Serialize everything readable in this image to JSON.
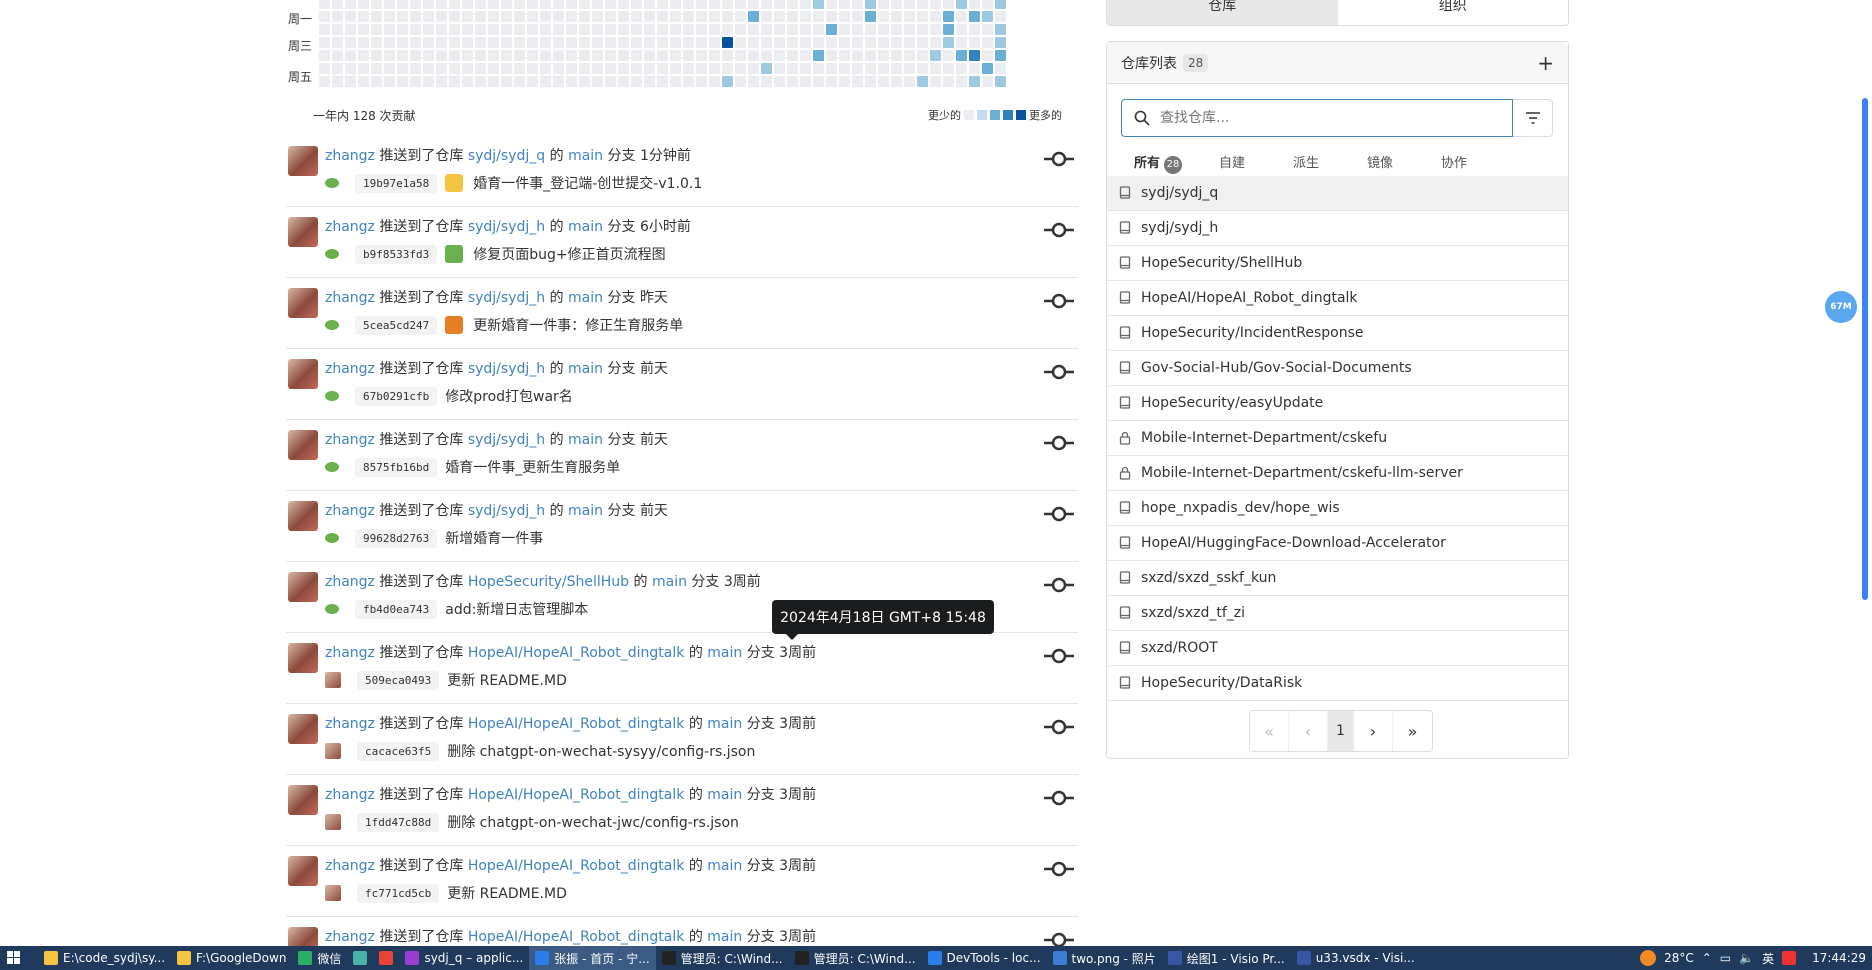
{
  "heatmap": {
    "day_labels": [
      "周一",
      "周三",
      "周五"
    ],
    "total_label": "一年内 128 次贡献",
    "legend_less": "更少的",
    "legend_more": "更多的",
    "colors": [
      "#ebedf0",
      "#c6dbef",
      "#9ecae1",
      "#6baed6",
      "#3182bd",
      "#08519c"
    ]
  },
  "feed": [
    {
      "user": "zhangz",
      "t1": "推送到了仓库",
      "repo": "sydj/sydj_q",
      "t2": "的",
      "branch": "main",
      "t3": "分支",
      "time": "1分钟前",
      "sha": "19b97e1a58",
      "message": "婚育一件事_登记端-创世提交-v1.0.1",
      "emoji": "sparkles-icon",
      "avatar_kind": "green"
    },
    {
      "user": "zhangz",
      "t1": "推送到了仓库",
      "repo": "sydj/sydj_h",
      "t2": "的",
      "branch": "main",
      "t3": "分支",
      "time": "6小时前",
      "sha": "b9f8533fd3",
      "message": "修复页面bug+修正首页流程图",
      "emoji": "bug-icon",
      "avatar_kind": "green"
    },
    {
      "user": "zhangz",
      "t1": "推送到了仓库",
      "repo": "sydj/sydj_h",
      "t2": "的",
      "branch": "main",
      "t3": "分支",
      "time": "昨天",
      "sha": "5cea5cd247",
      "message": "更新婚育一件事：修正生育服务单",
      "emoji": "rocket-icon",
      "avatar_kind": "green"
    },
    {
      "user": "zhangz",
      "t1": "推送到了仓库",
      "repo": "sydj/sydj_h",
      "t2": "的",
      "branch": "main",
      "t3": "分支",
      "time": "前天",
      "sha": "67b0291cfb",
      "message": "修改prod打包war名",
      "emoji": "",
      "avatar_kind": "green"
    },
    {
      "user": "zhangz",
      "t1": "推送到了仓库",
      "repo": "sydj/sydj_h",
      "t2": "的",
      "branch": "main",
      "t3": "分支",
      "time": "前天",
      "sha": "8575fb16bd",
      "message": "婚育一件事_更新生育服务单",
      "emoji": "",
      "avatar_kind": "green"
    },
    {
      "user": "zhangz",
      "t1": "推送到了仓库",
      "repo": "sydj/sydj_h",
      "t2": "的",
      "branch": "main",
      "t3": "分支",
      "time": "前天",
      "sha": "99628d2763",
      "message": "新增婚育一件事",
      "emoji": "",
      "avatar_kind": "green"
    },
    {
      "user": "zhangz",
      "t1": "推送到了仓库",
      "repo": "HopeSecurity/ShellHub",
      "t2": "的",
      "branch": "main",
      "t3": "分支",
      "time": "3周前",
      "sha": "fb4d0ea743",
      "message": "add:新增日志管理脚本",
      "emoji": "",
      "avatar_kind": "green"
    },
    {
      "user": "zhangz",
      "t1": "推送到了仓库",
      "repo": "HopeAI/HopeAI_Robot_dingtalk",
      "t2": "的",
      "branch": "main",
      "t3": "分支",
      "time": "3周前",
      "sha": "509eca0493",
      "message": "更新 README.MD",
      "emoji": "",
      "avatar_kind": "photo"
    },
    {
      "user": "zhangz",
      "t1": "推送到了仓库",
      "repo": "HopeAI/HopeAI_Robot_dingtalk",
      "t2": "的",
      "branch": "main",
      "t3": "分支",
      "time": "3周前",
      "sha": "cacace63f5",
      "message": "删除 chatgpt-on-wechat-sysyy/config-rs.json",
      "emoji": "",
      "avatar_kind": "photo"
    },
    {
      "user": "zhangz",
      "t1": "推送到了仓库",
      "repo": "HopeAI/HopeAI_Robot_dingtalk",
      "t2": "的",
      "branch": "main",
      "t3": "分支",
      "time": "3周前",
      "sha": "1fdd47c88d",
      "message": "删除 chatgpt-on-wechat-jwc/config-rs.json",
      "emoji": "",
      "avatar_kind": "photo"
    },
    {
      "user": "zhangz",
      "t1": "推送到了仓库",
      "repo": "HopeAI/HopeAI_Robot_dingtalk",
      "t2": "的",
      "branch": "main",
      "t3": "分支",
      "time": "3周前",
      "sha": "fc771cd5cb",
      "message": "更新 README.MD",
      "emoji": "",
      "avatar_kind": "photo"
    },
    {
      "user": "zhangz",
      "t1": "推送到了仓库",
      "repo": "HopeAI/HopeAI_Robot_dingtalk",
      "t2": "的",
      "branch": "main",
      "t3": "分支",
      "time": "3周前",
      "sha": "",
      "message": "",
      "emoji": "",
      "avatar_kind": "photo"
    }
  ],
  "tooltip": "2024年4月18日 GMT+8 15:48",
  "top_tabs": [
    "仓库",
    "组织"
  ],
  "repo_panel": {
    "title": "仓库列表",
    "count": "28",
    "add": "+",
    "search_placeholder": "查找仓库...",
    "tabs": [
      {
        "label": "所有",
        "count": "28"
      },
      {
        "label": "自建",
        "count": ""
      },
      {
        "label": "派生",
        "count": ""
      },
      {
        "label": "镜像",
        "count": ""
      },
      {
        "label": "协作",
        "count": ""
      }
    ],
    "repos": [
      {
        "name": "sydj/sydj_q",
        "icon": "repo-icon"
      },
      {
        "name": "sydj/sydj_h",
        "icon": "repo-icon"
      },
      {
        "name": "HopeSecurity/ShellHub",
        "icon": "repo-icon"
      },
      {
        "name": "HopeAI/HopeAI_Robot_dingtalk",
        "icon": "repo-icon"
      },
      {
        "name": "HopeSecurity/IncidentResponse",
        "icon": "repo-icon"
      },
      {
        "name": "Gov-Social-Hub/Gov-Social-Documents",
        "icon": "repo-icon"
      },
      {
        "name": "HopeSecurity/easyUpdate",
        "icon": "repo-icon"
      },
      {
        "name": "Mobile-Internet-Department/cskefu",
        "icon": "lock-icon"
      },
      {
        "name": "Mobile-Internet-Department/cskefu-llm-server",
        "icon": "lock-icon"
      },
      {
        "name": "hope_nxpadis_dev/hope_wis",
        "icon": "repo-icon"
      },
      {
        "name": "HopeAI/HuggingFace-Download-Accelerator",
        "icon": "repo-icon"
      },
      {
        "name": "sxzd/sxzd_sskf_kun",
        "icon": "repo-icon"
      },
      {
        "name": "sxzd/sxzd_tf_zi",
        "icon": "repo-icon"
      },
      {
        "name": "sxzd/ROOT",
        "icon": "repo-icon"
      },
      {
        "name": "HopeSecurity/DataRisk",
        "icon": "repo-icon"
      }
    ],
    "pager": {
      "first": "«",
      "prev": "‹",
      "current": "1",
      "next": "›",
      "last": "»"
    }
  },
  "float_badge": "67M",
  "taskbar": {
    "items": [
      {
        "label": "E:\\code_sydj\\sy...",
        "color": "#f5c542"
      },
      {
        "label": "F:\\GoogleDown",
        "color": "#f5c542"
      },
      {
        "label": "微信",
        "color": "#2aae67"
      },
      {
        "label": "",
        "color": "#4ab3a8"
      },
      {
        "label": "",
        "color": "#e94335"
      },
      {
        "label": "sydj_q – applic...",
        "color": "#9a3bd1"
      },
      {
        "label": "张振 - 首页 - 宁...",
        "color": "#2b7de9",
        "active": true
      },
      {
        "label": "管理员: C:\\Wind...",
        "color": "#222222"
      },
      {
        "label": "管理员: C:\\Wind...",
        "color": "#222222"
      },
      {
        "label": "DevTools - loc...",
        "color": "#2b7de9"
      },
      {
        "label": "two.png - 照片",
        "color": "#3d7bd4"
      },
      {
        "label": "绘图1 - Visio Pr...",
        "color": "#3955a3"
      },
      {
        "label": "u33.vsdx - Visi...",
        "color": "#3955a3"
      }
    ],
    "weather": "28°C",
    "ime": "英",
    "time": "17:44:29"
  }
}
